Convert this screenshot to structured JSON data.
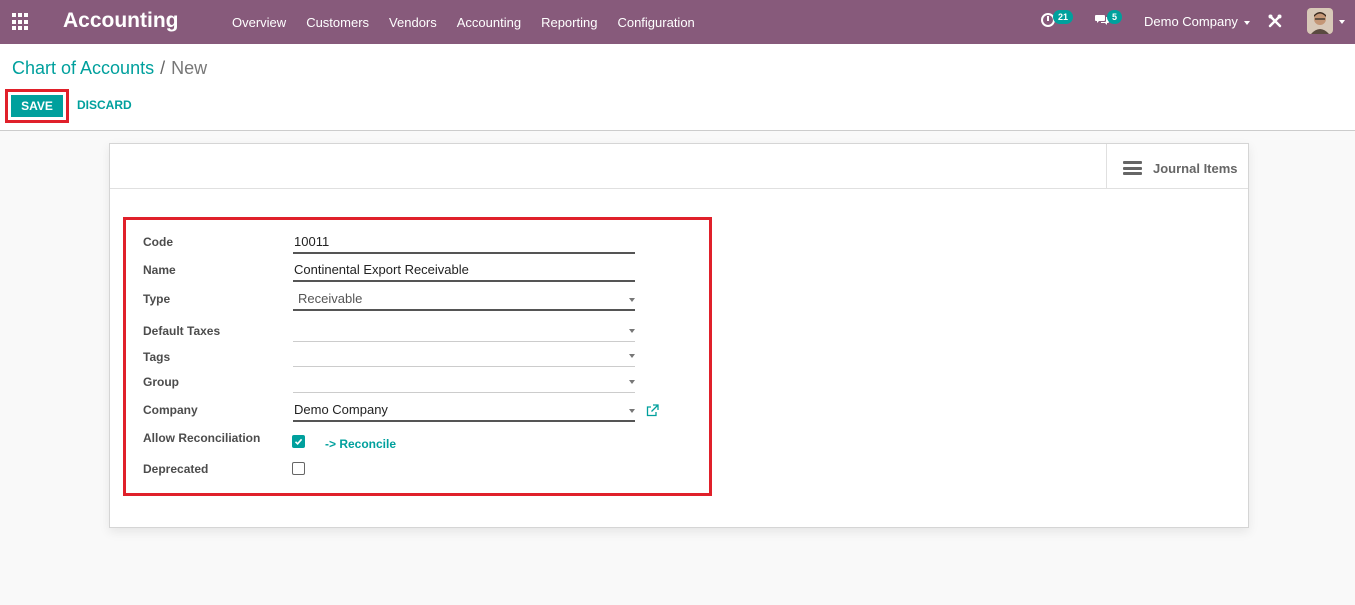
{
  "navbar": {
    "app_title": "Accounting",
    "menu": [
      "Overview",
      "Customers",
      "Vendors",
      "Accounting",
      "Reporting",
      "Configuration"
    ],
    "activity_count": "21",
    "message_count": "5",
    "company": "Demo Company",
    "bg_color": "#875a7b"
  },
  "breadcrumb": {
    "parent": "Chart of Accounts",
    "separator": "/",
    "current": "New"
  },
  "actions": {
    "save_label": "SAVE",
    "discard_label": "DISCARD"
  },
  "smart_button": {
    "label": "Journal Items",
    "icon": "list-icon"
  },
  "form": {
    "code_label": "Code",
    "code_value": "10011",
    "name_label": "Name",
    "name_value": "Continental Export Receivable",
    "type_label": "Type",
    "type_value": "Receivable",
    "taxes_label": "Default Taxes",
    "taxes_value": "",
    "tags_label": "Tags",
    "tags_value": "",
    "group_label": "Group",
    "group_value": "",
    "company_label": "Company",
    "company_value": "Demo Company",
    "reconcile_label": "Allow Reconciliation",
    "reconcile_checked": true,
    "reconcile_link": "-> Reconcile",
    "deprecated_label": "Deprecated",
    "deprecated_checked": false
  },
  "colors": {
    "primary": "#00a09d",
    "highlight": "#e0202a"
  }
}
